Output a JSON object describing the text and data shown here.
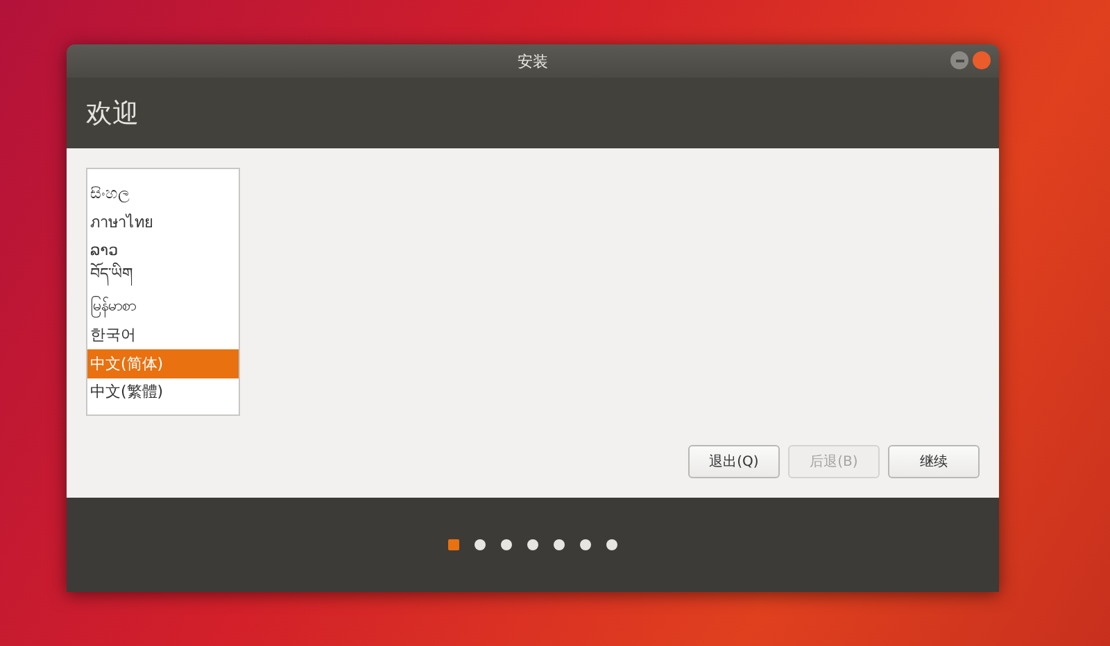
{
  "window": {
    "title": "安装"
  },
  "header": {
    "title": "欢迎"
  },
  "languages": [
    {
      "label": "සිංහල",
      "selected": false
    },
    {
      "label": "ภาษาไทย",
      "selected": false
    },
    {
      "label": "ລາວ",
      "selected": false
    },
    {
      "label": "བོད་ཡིག",
      "selected": false
    },
    {
      "label": "မြန်မာစာ",
      "selected": false
    },
    {
      "label": "한국어",
      "selected": false
    },
    {
      "label": "中文(简体)",
      "selected": true
    },
    {
      "label": "中文(繁體)",
      "selected": false
    }
  ],
  "buttons": [
    {
      "label": "退出(Q)",
      "disabled": false
    },
    {
      "label": "后退(B)",
      "disabled": true
    },
    {
      "label": "继续",
      "disabled": false
    }
  ],
  "steps": [
    {
      "selected": true
    },
    {
      "selected": false
    },
    {
      "selected": false
    },
    {
      "selected": false
    },
    {
      "selected": false
    },
    {
      "selected": false
    },
    {
      "selected": false
    }
  ]
}
